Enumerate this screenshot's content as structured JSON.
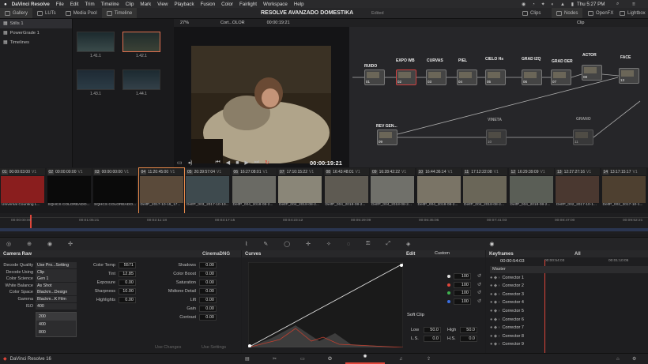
{
  "menubar": {
    "app_name": "DaVinci Resolve",
    "items": [
      "File",
      "Edit",
      "Trim",
      "Timeline",
      "Clip",
      "Mark",
      "View",
      "Playback",
      "Fusion",
      "Color",
      "Fairlight",
      "Workspace",
      "Help"
    ],
    "clock": "Thu 5:27 PM"
  },
  "toolbar": {
    "gallery": "Gallery",
    "luts": "LUTs",
    "media_pool": "Media Pool",
    "timeline": "Timeline",
    "project_title": "RESOLVE AVANZADO DOMESTIKA",
    "edited": "Edited",
    "clips": "Clips",
    "nodes": "Nodes",
    "openfx": "OpenFX",
    "lightbox": "Lightbox"
  },
  "albums": [
    {
      "label": "Stills 1"
    },
    {
      "label": "PowerGrade 1"
    },
    {
      "label": "Timelines"
    }
  ],
  "stills": [
    "1.41.1",
    "1.42.1",
    "1.43.1",
    "1.44.1"
  ],
  "viewer": {
    "zoom": "27%",
    "clip_name": "Cort...OLOR",
    "timecode_top": "00:00:19:21",
    "timecode_main": "00:00:19:21"
  },
  "node_panel": {
    "mode": "Clip"
  },
  "nodes": [
    {
      "label": "RUIDO",
      "num": "01"
    },
    {
      "label": "EXPO WB",
      "num": "02"
    },
    {
      "label": "CURVAS",
      "num": "03"
    },
    {
      "label": "PIEL",
      "num": "04"
    },
    {
      "label": "CIELO Hs",
      "num": "05"
    },
    {
      "label": "GRAD IZQ",
      "num": "06"
    },
    {
      "label": "GRAD DER",
      "num": "07"
    },
    {
      "label": "ACTOR",
      "num": "08"
    },
    {
      "label": "FACE",
      "num": "13"
    },
    {
      "label": "REV GEN...",
      "num": "09"
    },
    {
      "label": "VINETA",
      "num": "10"
    },
    {
      "label": "GRANO",
      "num": "11"
    }
  ],
  "clips": [
    {
      "idx": "01",
      "tc": "00:00:03:00",
      "track": "V1",
      "label": "Universal Counting L..."
    },
    {
      "idx": "02",
      "tc": "00:00:00:00",
      "track": "V1",
      "label": "SQHCS COLOREADO..."
    },
    {
      "idx": "03",
      "tc": "00:00:00:00",
      "track": "V1",
      "label": "SQHCS COLOREADO..."
    },
    {
      "idx": "04",
      "tc": "11:20:45:00",
      "track": "V1",
      "label": "DelfP_2017-10-19_17..."
    },
    {
      "idx": "05",
      "tc": "20:39:57:04",
      "track": "V1",
      "label": "DelfP_003_2017-10-19..."
    },
    {
      "idx": "06",
      "tc": "16:27:08:01",
      "track": "V1",
      "label": "DelfP_004_2018-08-2..."
    },
    {
      "idx": "07",
      "tc": "17:10:15:22",
      "track": "V1",
      "label": "DelfP_004_2018-08-2..."
    },
    {
      "idx": "08",
      "tc": "16:43:48:01",
      "track": "V1",
      "label": "DelfP_004_2018-08-2..."
    },
    {
      "idx": "09",
      "tc": "16:28:42:22",
      "track": "V1",
      "label": "DelfP_004_2018-08-2..."
    },
    {
      "idx": "10",
      "tc": "16:44:36:14",
      "track": "V1",
      "label": "DelfP_004_2018-08-2..."
    },
    {
      "idx": "11",
      "tc": "17:12:22:08",
      "track": "V1",
      "label": "DelfP_004_2018-08-2..."
    },
    {
      "idx": "12",
      "tc": "16:29:39:09",
      "track": "V1",
      "label": "DelfP_004_2018-08-2..."
    },
    {
      "idx": "13",
      "tc": "12:27:27:16",
      "track": "V1",
      "label": "DelfP_002_2017-10-1..."
    },
    {
      "idx": "14",
      "tc": "13:17:15:17",
      "track": "V1",
      "label": "DelfP_002_2017-10-1..."
    }
  ],
  "ruler_ticks": [
    "00:00:00:00",
    "00:01:05:21",
    "00:02:11:18",
    "00:03:17:15",
    "00:04:23:12",
    "00:05:29:09",
    "00:06:35:06",
    "00:07:41:03",
    "00:08:47:00",
    "00:09:52:21"
  ],
  "camera_raw": {
    "title": "Camera Raw",
    "format": "CinemaDNG",
    "fields": [
      {
        "label": "Decode Quality",
        "value": "Use Pro...Setting"
      },
      {
        "label": "Decode Using",
        "value": "Clip"
      },
      {
        "label": "Color Science",
        "value": "Gen 1"
      },
      {
        "label": "White Balance",
        "value": "As Shot"
      },
      {
        "label": "Color Space",
        "value": "Blackm...Design"
      },
      {
        "label": "Gamma",
        "value": "Blackm...K Film"
      },
      {
        "label": "ISO",
        "value": "400"
      }
    ],
    "iso_options": [
      "200",
      "400",
      "800"
    ],
    "mid": [
      {
        "label": "Color Temp",
        "value": "5571"
      },
      {
        "label": "Tint",
        "value": "12.85"
      },
      {
        "label": "Exposure",
        "value": "0.00"
      },
      {
        "label": "Sharpness",
        "value": "10.00"
      },
      {
        "label": "Highlights",
        "value": "0.00"
      }
    ],
    "right": [
      {
        "label": "Shadows",
        "value": "0.00"
      },
      {
        "label": "Color Boost",
        "value": "0.00"
      },
      {
        "label": "Saturation",
        "value": "0.00"
      },
      {
        "label": "Midtone Detail",
        "value": "0.00"
      },
      {
        "label": "Lift",
        "value": "0.00"
      },
      {
        "label": "Gain",
        "value": "0.00"
      },
      {
        "label": "Contrast",
        "value": "0.00"
      }
    ],
    "use_changes": "Use Changes",
    "use_settings": "Use Settings"
  },
  "curves": {
    "title": "Curves",
    "mode": "Custom"
  },
  "edit_panel": {
    "title": "Edit",
    "values": [
      "100",
      "100",
      "100",
      "100"
    ],
    "soft_clip": "Soft Clip",
    "low_label": "Low",
    "low": "50.0",
    "high_label": "High",
    "high": "50.0",
    "ls_label": "L.S.",
    "ls": "0.0",
    "hs_label": "H.S.",
    "hs": "0.0"
  },
  "keyframes": {
    "title": "Keyframes",
    "filter": "All",
    "tc": "00:00:54:03",
    "tc2": "00:00:54:03",
    "tc3": "00:01:10:05",
    "rows": [
      "Master",
      "Corrector 1",
      "Corrector 2",
      "Corrector 3",
      "Corrector 4",
      "Corrector 5",
      "Corrector 6",
      "Corrector 7",
      "Corrector 8",
      "Corrector 9"
    ]
  },
  "bottombar": {
    "app_version": "DaVinci Resolve 16"
  },
  "colors": {
    "accent_red": "#e0463a",
    "node_green": "#7ec850",
    "selection_orange": "#e88a4a"
  }
}
